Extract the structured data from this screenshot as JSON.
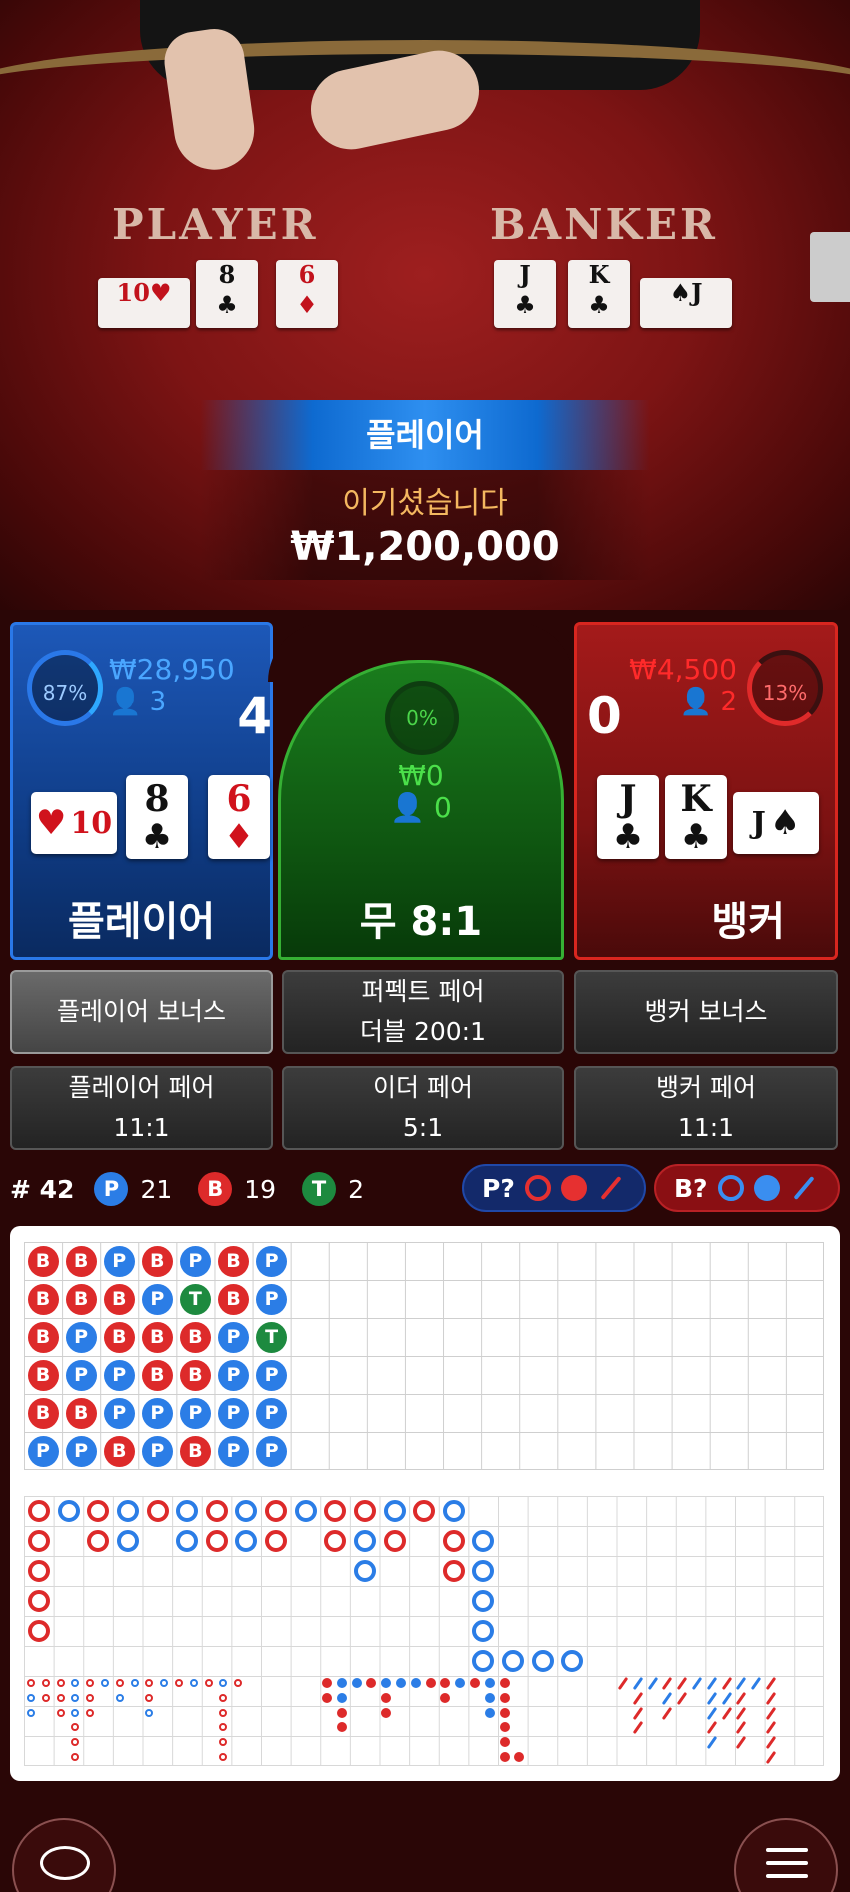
{
  "table": {
    "player_label": "PLAYER",
    "banker_label": "BANKER",
    "player_cards": [
      {
        "rank": "10",
        "suit": "♥",
        "red": true
      },
      {
        "rank": "8",
        "suit": "♣",
        "red": false
      },
      {
        "rank": "6",
        "suit": "♦",
        "red": true
      }
    ],
    "banker_cards": [
      {
        "rank": "J",
        "suit": "♣",
        "red": false
      },
      {
        "rank": "K",
        "suit": "♣",
        "red": false
      },
      {
        "rank": "J",
        "suit": "♠",
        "red": false
      }
    ]
  },
  "result": {
    "winner": "플레이어",
    "message": "이기셨습니다",
    "amount": "₩1,200,000"
  },
  "bets": {
    "player": {
      "percent": "87%",
      "stake": "₩28,950",
      "count": "3",
      "score": "4",
      "label": "플레이어"
    },
    "tie": {
      "percent": "0%",
      "stake": "₩0",
      "count": "0",
      "label": "무 8:1"
    },
    "banker": {
      "percent": "13%",
      "stake": "₩4,500",
      "count": "2",
      "score": "0",
      "label": "뱅커"
    }
  },
  "side_bets": [
    {
      "line1": "플레이어 보너스",
      "line2": ""
    },
    {
      "line1": "퍼펙트 페어",
      "line2": "더블 200:1"
    },
    {
      "line1": "뱅커 보너스",
      "line2": ""
    },
    {
      "line1": "플레이어 페어",
      "line2": "11:1"
    },
    {
      "line1": "이더 페어",
      "line2": "5:1"
    },
    {
      "line1": "뱅커 페어",
      "line2": "11:1"
    }
  ],
  "stats": {
    "round_label": "# 42",
    "player_badge": "P",
    "player_count": "21",
    "banker_badge": "B",
    "banker_count": "19",
    "tie_badge": "T",
    "tie_count": "2"
  },
  "predict": {
    "player": "P?",
    "banker": "B?"
  },
  "bead_road": [
    [
      "B",
      "B",
      "B",
      "B",
      "B",
      "P"
    ],
    [
      "B",
      "B",
      "P",
      "P",
      "B",
      "P"
    ],
    [
      "P",
      "B",
      "B",
      "P",
      "P",
      "B"
    ],
    [
      "B",
      "P",
      "B",
      "B",
      "P",
      "P"
    ],
    [
      "P",
      "T",
      "B",
      "B",
      "P",
      "B"
    ],
    [
      "B",
      "B",
      "P",
      "P",
      "P",
      "P"
    ],
    [
      "P",
      "P",
      "T",
      "P",
      "P",
      "P"
    ]
  ],
  "colors": {
    "banker": "#dd2a2a",
    "player": "#2b7de6",
    "tie": "#1d8a3f"
  },
  "icons": {
    "chip": "chip-icon",
    "menu": "menu-icon"
  }
}
